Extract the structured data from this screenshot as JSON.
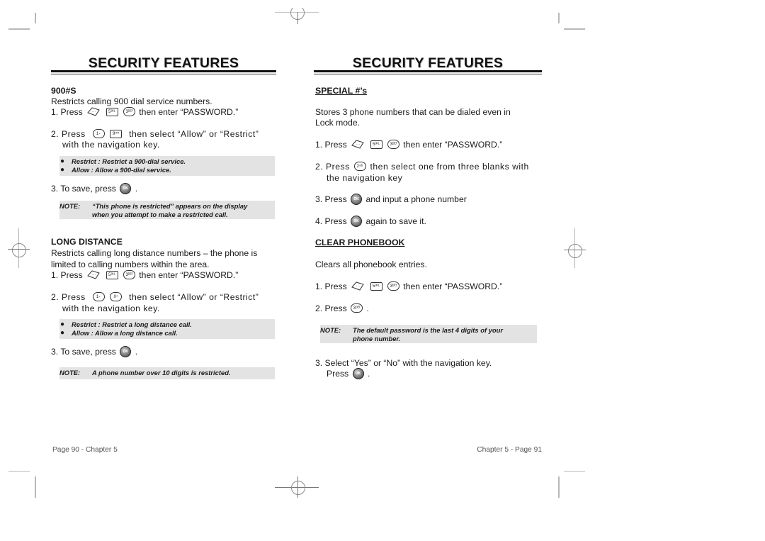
{
  "left_page": {
    "title": "SECURITY FEATURES",
    "section_900": {
      "heading": "900#S",
      "description": "Restricts calling 900 dial service numbers.",
      "step1": {
        "prefix": "1. Press",
        "suffix": "then enter “PASSWORD.”",
        "keys": [
          "menu",
          "5 JKL",
          "3 DEF"
        ]
      },
      "step2": {
        "prefix": "2. Press",
        "suffix": "then select “Allow” or “Restrict”",
        "line2": "with the navigation key.",
        "keys": [
          "1",
          "9 WXYZ"
        ]
      },
      "options": [
        {
          "bullet": "●",
          "text": "Restrict : Restrict a 900-dial service."
        },
        {
          "bullet": "●",
          "text": "Allow : Allow a 900-dial service."
        }
      ],
      "step3": {
        "prefix": "3. To save, press",
        "suffix": ".",
        "key": "OK"
      },
      "note": {
        "label": "NOTE:",
        "line1": "“This phone is restricted” appears on the display",
        "line2": "when you attempt to make a restricted call."
      }
    },
    "section_long": {
      "heading": "LONG DISTANCE",
      "description_line1": "Restricts calling long distance numbers – the phone is",
      "description_line2": "limited to calling numbers within the area.",
      "step1": {
        "prefix": "1. Press",
        "suffix": "then enter “PASSWORD.”",
        "keys": [
          "menu",
          "5 JKL",
          "3 DEF"
        ]
      },
      "step2": {
        "prefix": "2. Press",
        "suffix": "then select “Allow” or “Restrict”",
        "line2": "with the navigation key.",
        "keys": [
          "1",
          "0 NEXT"
        ]
      },
      "options": [
        {
          "bullet": "●",
          "text": "Restrict : Restrict a long distance call."
        },
        {
          "bullet": "●",
          "text": "Allow : Allow a long distance call."
        }
      ],
      "step3": {
        "prefix": "3. To save, press",
        "suffix": ".",
        "key": "OK"
      },
      "note": {
        "label": "NOTE:",
        "line1": "A phone number over 10 digits is restricted."
      }
    },
    "footer": "Page 90 - Chapter 5"
  },
  "right_page": {
    "title": "SECURITY FEATURES",
    "section_special": {
      "heading": "SPECIAL #’s",
      "description_line1": "Stores 3 phone numbers that can be dialed even in",
      "description_line2": "Lock mode.",
      "step1": {
        "prefix": "1. Press",
        "suffix": "then enter “PASSWORD.”",
        "keys": [
          "menu",
          "5 JKL",
          "3 DEF"
        ]
      },
      "step2": {
        "prefix": "2. Press",
        "suffix": "then select one from three blanks with",
        "line2": "the navigation key",
        "keys": [
          "2 ABC"
        ]
      },
      "step3": {
        "prefix": "3. Press",
        "suffix": "and input a phone number",
        "key": "OK"
      },
      "step4": {
        "prefix": "4. Press",
        "suffix": "again to save it.",
        "key": "OK"
      }
    },
    "section_clear": {
      "heading": "CLEAR PHONEBOOK",
      "description": "Clears all phonebook entries.",
      "step1": {
        "prefix": "1. Press",
        "suffix": "then enter “PASSWORD.”",
        "keys": [
          "menu",
          "5 JKL",
          "3 DEF"
        ]
      },
      "step2": {
        "prefix": "2. Press",
        "suffix": ".",
        "keys": [
          "3 DEF"
        ]
      },
      "note": {
        "label": "NOTE:",
        "line1": "The default password is the last 4 digits of your",
        "line2": "phone number."
      },
      "step3": {
        "line1": "3. Select “Yes” or “No” with the navigation key.",
        "prefix": "Press",
        "suffix": ".",
        "key": "OK"
      }
    },
    "footer": "Chapter 5 - Page 91"
  },
  "key_glyphs": {
    "menu": "···",
    "k5": "5ᴶᴷᴸ",
    "k3": "3ᴰᴱᶠ",
    "k1": "1‐",
    "k9": "9ʷˣ",
    "k0": "0ⁿ",
    "k2": "2ᵃᵇ",
    "ok": "OK"
  }
}
